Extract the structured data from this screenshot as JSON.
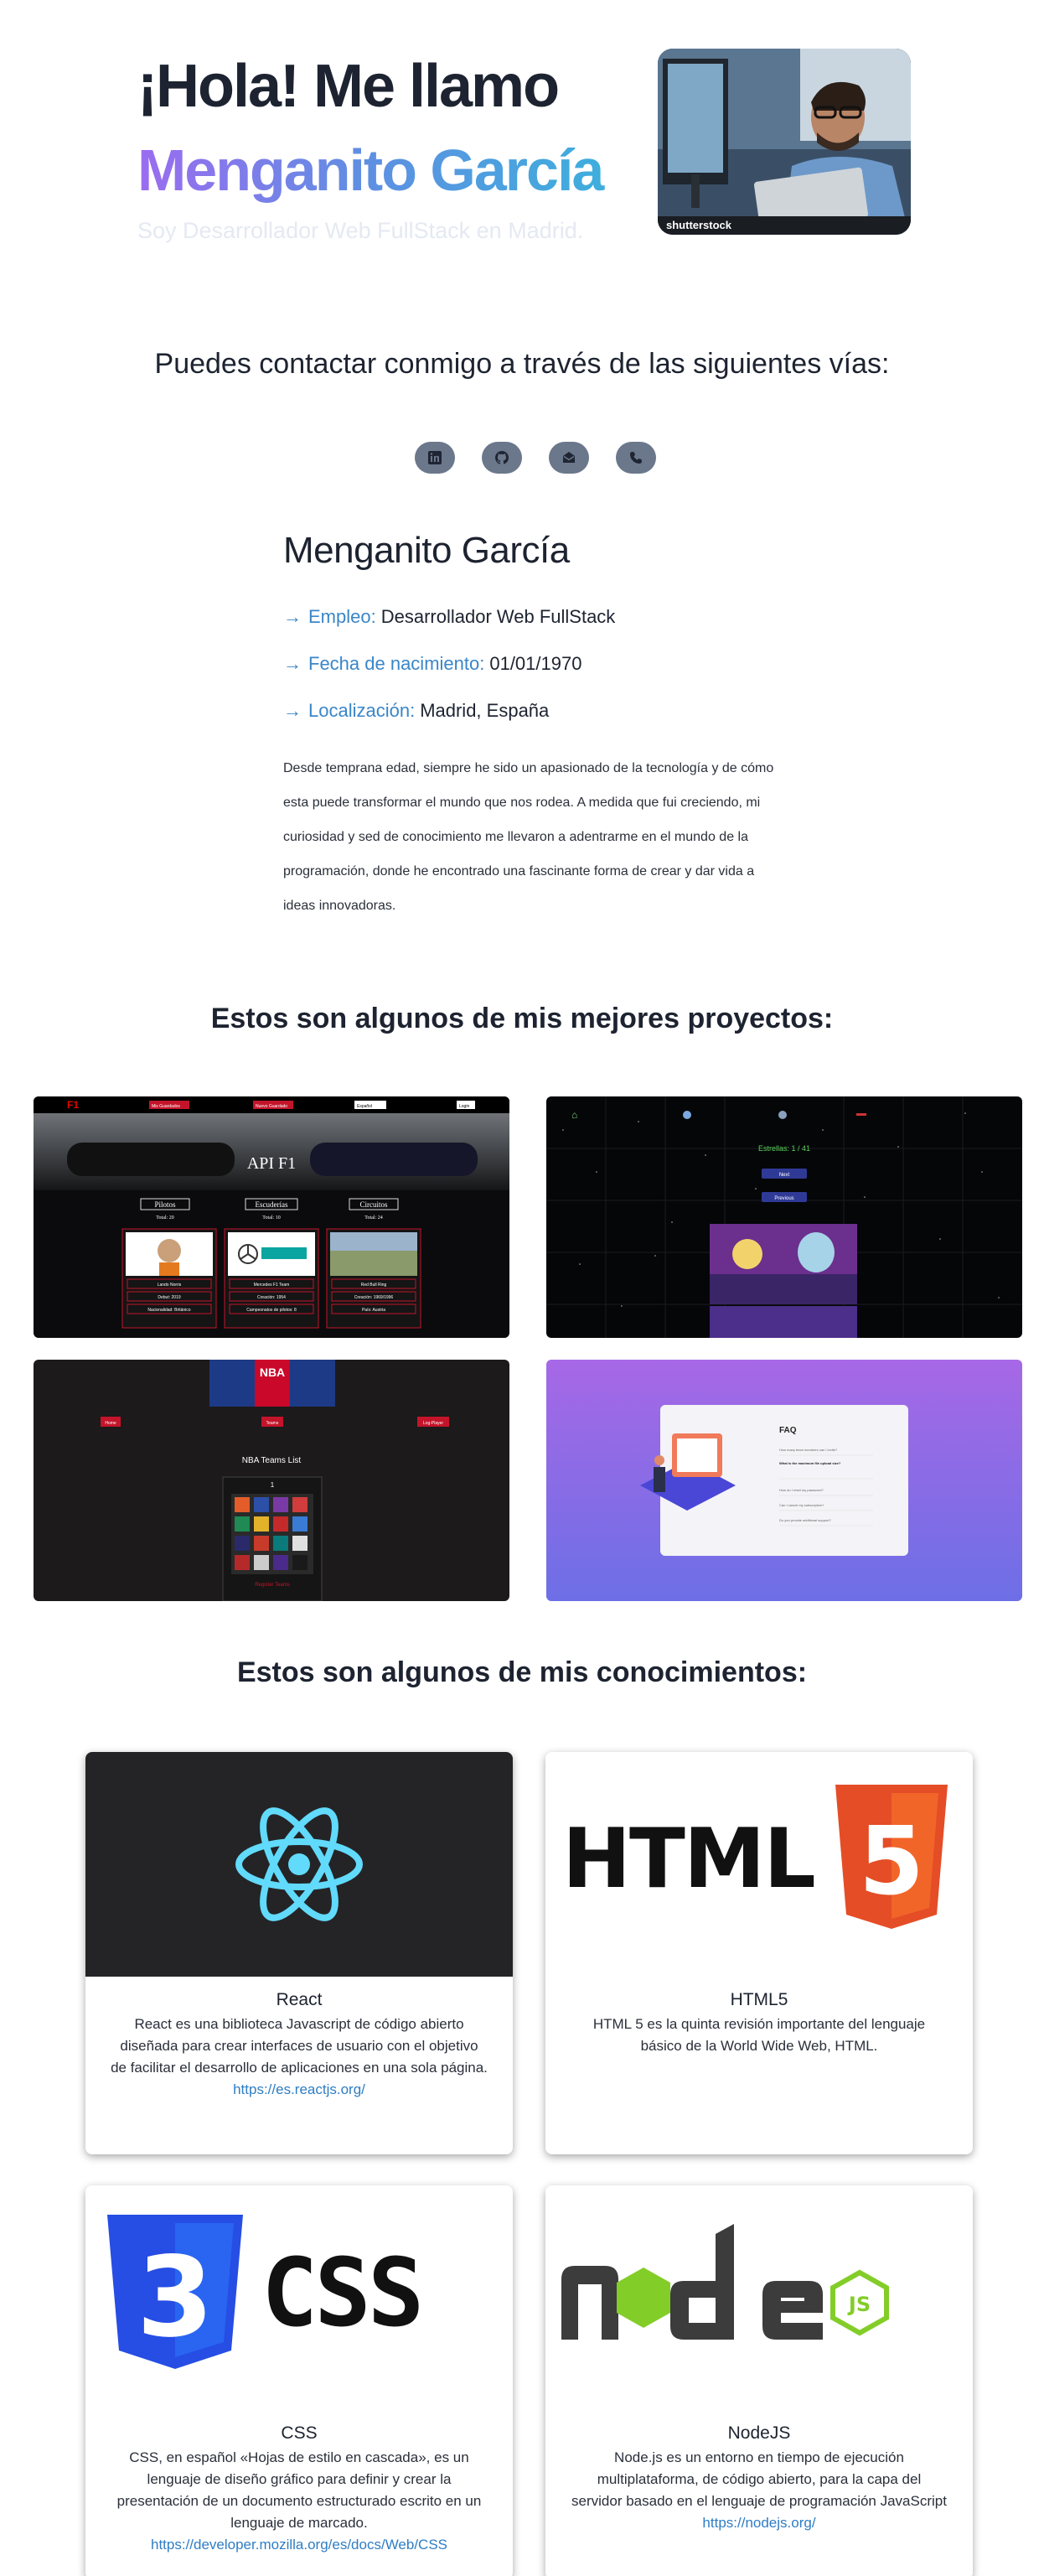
{
  "hero": {
    "greeting": "¡Hola! Me llamo",
    "name": "Menganito García",
    "subtitle": "Soy Desarrollador Web FullStack en Madrid.",
    "photo_watermark": "shutterstock"
  },
  "contact": {
    "heading": "Puedes contactar conmigo a través de las siguientes vías:",
    "icons": [
      "linkedin-icon",
      "github-icon",
      "email-icon",
      "phone-icon"
    ]
  },
  "profile": {
    "name": "Menganito García",
    "facts": [
      {
        "label": "Empleo:",
        "value": "Desarrollador Web FullStack"
      },
      {
        "label": "Fecha de nacimiento:",
        "value": "01/01/1970"
      },
      {
        "label": "Localización:",
        "value": "Madrid, España"
      }
    ],
    "bio": "Desde temprana edad, siempre he sido un apasionado de la tecnología y de cómo esta puede transformar el mundo que nos rodea. A medida que fui creciendo, mi curiosidad y sed de conocimiento me llevaron a adentrarme en el mundo de la programación, donde he encontrado una fascinante forma de crear y dar vida a ideas innovadoras."
  },
  "projects": {
    "heading": "Estos son algunos de mis mejores proyectos:",
    "f1": {
      "title": "API F1",
      "tabs": [
        "Pilotos",
        "Escuderías",
        "Circuitos"
      ],
      "totals": [
        "Total: 20",
        "Total: 10",
        "Total: 24"
      ],
      "buttons": [
        "Mis Guardados",
        "Nuevo Guardado",
        "Español",
        "Login"
      ],
      "driver_rows": [
        "Lando Norris",
        "Debut: 2019",
        "Nacionalidad: Británico"
      ],
      "team_rows": [
        "Mercedes F1 Team",
        "Creación: 1954",
        "Campeonatos de pilotos: 8"
      ],
      "circuit_rows": [
        "Red Bull Ring",
        "Creación: 1969/1996",
        "País: Austria"
      ]
    },
    "rick": {
      "label": "Estrellas: 1 / 41",
      "buttons": [
        "Next",
        "Previous"
      ]
    },
    "nba": {
      "buttons": [
        "Home",
        "Teams",
        "Log-Player"
      ],
      "title": "NBA Teams List",
      "footer": "Register Teams"
    },
    "faq": {
      "title": "FAQ",
      "items": [
        "How many team members can I invite?",
        "What is the maximum file upload size?",
        "How do I reset my password?",
        "Can I cancel my subscription?",
        "Do you provide additional support?"
      ]
    }
  },
  "skills": {
    "heading": "Estos son algunos de mis conocimientos:",
    "cards": [
      {
        "title": "React",
        "desc": "React es una biblioteca Javascript de código abierto diseñada para crear interfaces de usuario con el objetivo de facilitar el desarrollo de aplicaciones en una sola página.",
        "link": "https://es.reactjs.org/"
      },
      {
        "title": "HTML5",
        "desc": "HTML 5 es la quinta revisión importante del lenguaje básico de la World Wide Web, HTML.",
        "link": ""
      },
      {
        "title": "CSS",
        "desc": "CSS, en español «Hojas de estilo en cascada», es un lenguaje de diseño gráfico para definir y crear la presentación de un documento estructurado escrito en un lenguaje de marcado.",
        "link": "https://developer.mozilla.org/es/docs/Web/CSS"
      },
      {
        "title": "NodeJS",
        "desc": "Node.js es un entorno en tiempo de ejecución multiplataforma, de código abierto, para la capa del servidor basado en el lenguaje de programación JavaScript",
        "link": "https://nodejs.org/"
      }
    ],
    "logo_text": {
      "html": "HTML",
      "html_num": "5",
      "css": "CSS",
      "css_num": "3",
      "node": "node",
      "node_js": "JS"
    }
  },
  "colors": {
    "accent": "#3a86c8",
    "gradient_start": "#9b6cf0",
    "gradient_end": "#39b3dc",
    "social_bg": "#6b778b",
    "react": "#61dafb",
    "html5": "#e44d26",
    "css3": "#264de4",
    "node": "#83cd29"
  }
}
